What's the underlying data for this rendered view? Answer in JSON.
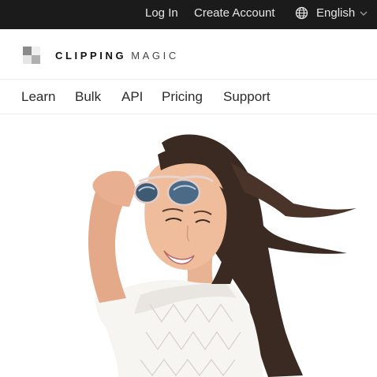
{
  "topbar": {
    "login_label": "Log In",
    "create_account_label": "Create Account",
    "language_label": "English",
    "language_icon": "globe-icon",
    "dropdown_icon": "chevron-down-icon"
  },
  "brand": {
    "name_bold": "CLIPPING",
    "name_light": "MAGIC",
    "logo_icon": "checker-logo-icon"
  },
  "nav": {
    "items": [
      "Learn",
      "Bulk",
      "API",
      "Pricing",
      "Support"
    ]
  },
  "hero": {
    "image": "woman-with-sunglasses-cutout"
  },
  "colors": {
    "topbar_bg": "#1b1b1b",
    "topbar_text": "#e6e6e6",
    "page_bg": "#ffffff"
  }
}
